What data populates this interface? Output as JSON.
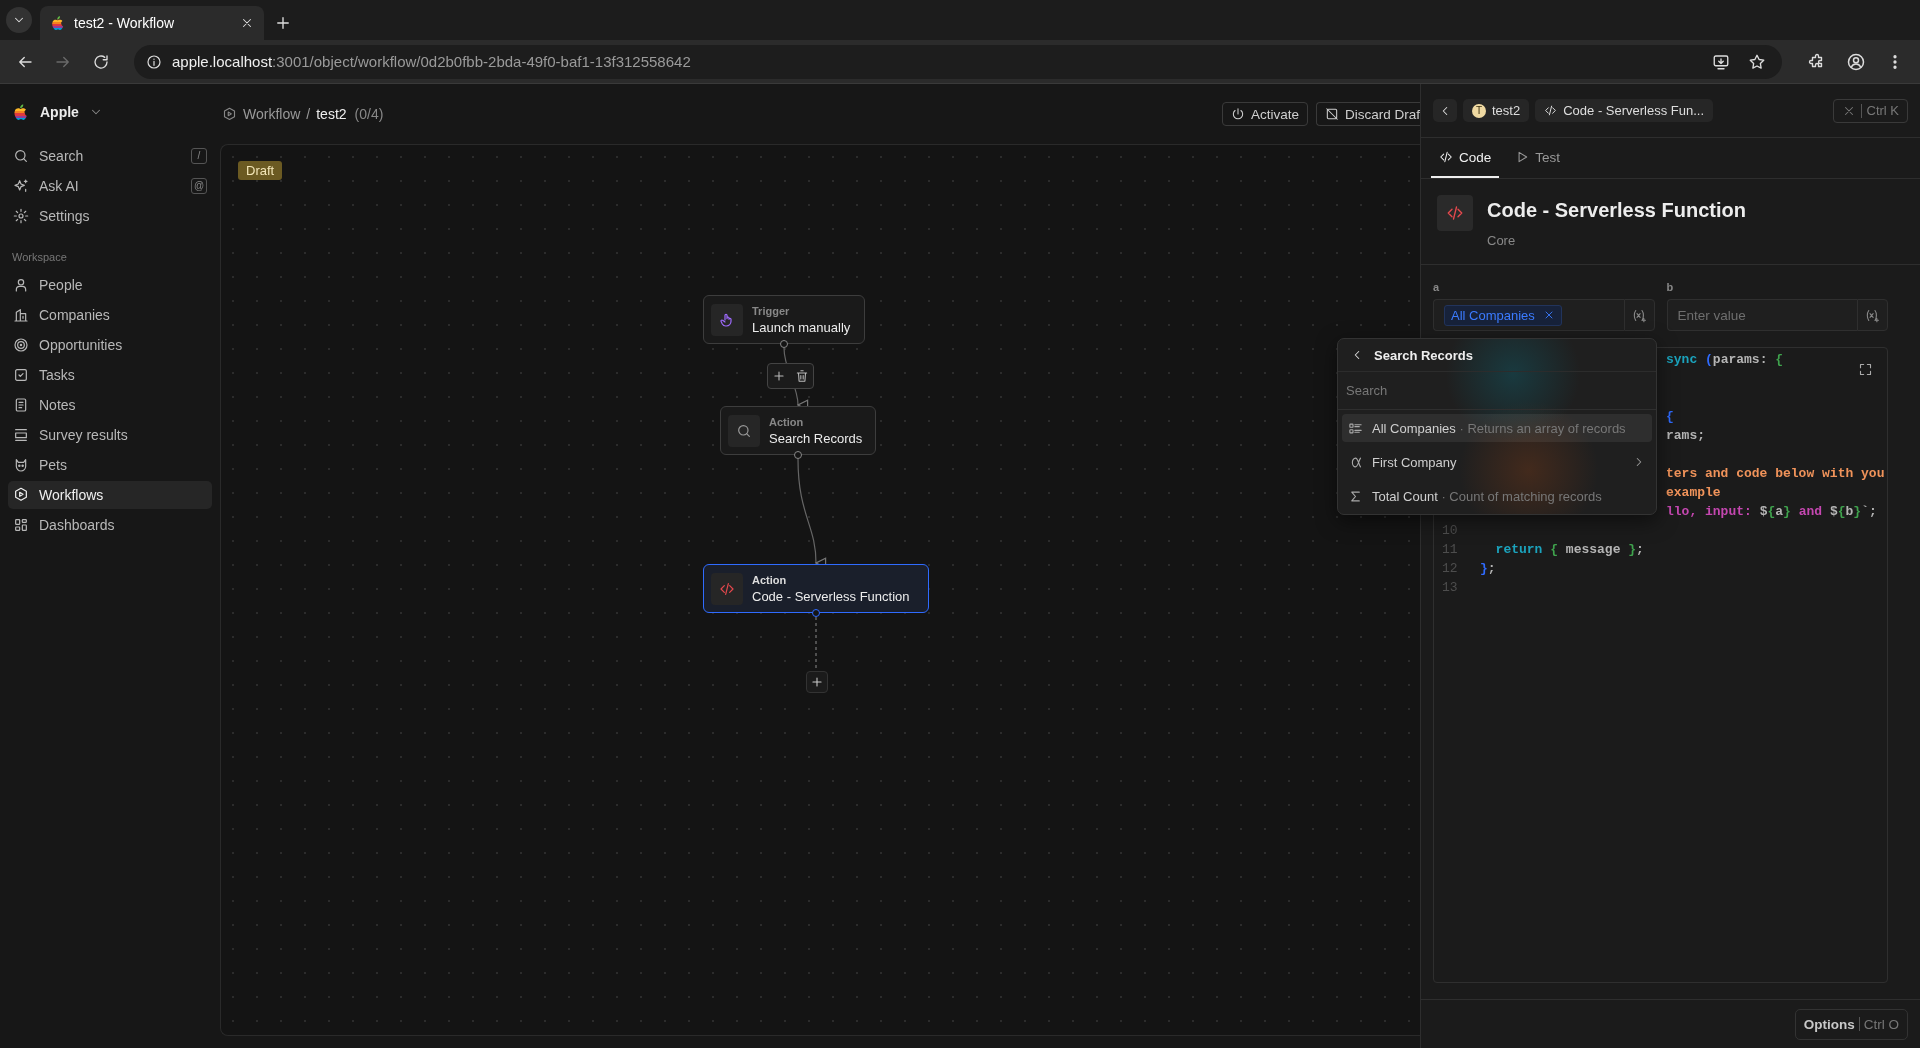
{
  "browser": {
    "tab": {
      "title": "test2 - Workflow",
      "selected": true
    },
    "url": {
      "host": "apple.localhost",
      "path": ":3001/object/workflow/0d2b0fbb-2bda-49f0-baf1-13f312558642"
    },
    "forward_disabled": true
  },
  "workspace": {
    "name": "Apple"
  },
  "sidebar": {
    "items": [
      {
        "label": "Search",
        "shortcut": "/",
        "selected": false
      },
      {
        "label": "Ask AI",
        "shortcut": "@",
        "selected": false
      },
      {
        "label": "Settings",
        "selected": false
      }
    ],
    "section_title": "Workspace",
    "workspace_items": [
      {
        "label": "People",
        "selected": false
      },
      {
        "label": "Companies",
        "selected": false
      },
      {
        "label": "Opportunities",
        "selected": false
      },
      {
        "label": "Tasks",
        "selected": false
      },
      {
        "label": "Notes",
        "selected": false
      },
      {
        "label": "Survey results",
        "selected": false
      },
      {
        "label": "Pets",
        "selected": false
      },
      {
        "label": "Workflows",
        "selected": true
      },
      {
        "label": "Dashboards",
        "selected": false
      }
    ]
  },
  "breadcrumb": {
    "parent": "Workflow",
    "separator": "/",
    "current": "test2",
    "count": "(0/4)"
  },
  "actions": [
    "Activate",
    "Discard Draf"
  ],
  "canvas": {
    "status": "Draft",
    "nodes": [
      {
        "type": "Trigger",
        "title": "Launch manually",
        "selected": false
      },
      {
        "type": "Action",
        "title": "Search Records",
        "selected": false
      },
      {
        "type": "Action",
        "title": "Code - Serverless Function",
        "selected": true
      }
    ]
  },
  "panel": {
    "crumbs": [
      {
        "avatar": "T",
        "label": "test2"
      },
      {
        "label": "Code - Serverless Fun..."
      }
    ],
    "close_shortcut": "Ctrl K",
    "tabs": [
      {
        "label": "Code",
        "selected": true
      },
      {
        "label": "Test",
        "selected": false
      }
    ],
    "title": "Code - Serverless Function",
    "subtitle": "Core",
    "fields": [
      {
        "label": "a",
        "chip": "All Companies"
      },
      {
        "label": "b",
        "placeholder": "Enter value"
      }
    ],
    "editor": {
      "lines": [
        {
          "kind": "code",
          "segments": [
            {
              "text": "sync",
              "color": "#1ba3bd"
            },
            {
              "text": " (",
              "color": "#2f6bff"
            },
            {
              "text": "params: ",
              "color": "#b5b5b5"
            },
            {
              "text": "{",
              "color": "#3fa34d"
            }
          ]
        },
        {
          "kind": "blank"
        },
        {
          "kind": "blank"
        },
        {
          "kind": "code",
          "segments": [
            {
              "text": "{",
              "color": "#2f6bff"
            }
          ]
        },
        {
          "kind": "code",
          "segments": [
            {
              "text": "rams;",
              "color": "#b5b5b5"
            }
          ]
        },
        {
          "kind": "blank"
        },
        {
          "kind": "code",
          "segments": [
            {
              "text": "ters and code below with you",
              "color": "#f0935a"
            }
          ]
        },
        {
          "kind": "code",
          "segments": [
            {
              "text": "example",
              "color": "#f0935a"
            }
          ]
        },
        {
          "kind": "code",
          "segments": [
            {
              "text": "llo, input: ",
              "color": "#c447b0"
            },
            {
              "text": "$",
              "color": "#b5b5b5"
            },
            {
              "text": "{",
              "color": "#3fa34d"
            },
            {
              "text": "a",
              "color": "#b5b5b5"
            },
            {
              "text": "}",
              "color": "#3fa34d"
            },
            {
              "text": " and ",
              "color": "#c447b0"
            },
            {
              "text": "$",
              "color": "#b5b5b5"
            },
            {
              "text": "{",
              "color": "#3fa34d"
            },
            {
              "text": "b",
              "color": "#b5b5b5"
            },
            {
              "text": "}",
              "color": "#3fa34d"
            },
            {
              "text": "`;",
              "color": "#b5b5b5"
            }
          ]
        },
        {
          "kind": "code",
          "number": "10"
        },
        {
          "kind": "code",
          "number": "11",
          "segments": [
            {
              "text": "  return",
              "color": "#1ba3bd"
            },
            {
              "text": " { ",
              "color": "#3fa34d"
            },
            {
              "text": "message",
              "color": "#b5b5b5"
            },
            {
              "text": " }",
              "color": "#3fa34d"
            },
            {
              "text": ";",
              "color": "#b5b5b5"
            }
          ]
        },
        {
          "kind": "code",
          "number": "12",
          "segments": [
            {
              "text": "}",
              "color": "#2f6bff"
            },
            {
              "text": ";",
              "color": "#b5b5b5"
            }
          ]
        },
        {
          "kind": "code",
          "number": "13"
        }
      ]
    },
    "popup": {
      "title": "Search Records",
      "search_placeholder": "Search",
      "items": [
        {
          "label": "All Companies",
          "hint": "· Returns an array of records",
          "selected": true,
          "expandable": false
        },
        {
          "label": "First Company",
          "selected": false,
          "expandable": true
        },
        {
          "label": "Total Count",
          "hint": "· Count of matching records",
          "selected": false,
          "expandable": false
        }
      ]
    },
    "footer": {
      "label": "Options",
      "shortcut": "Ctrl O"
    }
  }
}
